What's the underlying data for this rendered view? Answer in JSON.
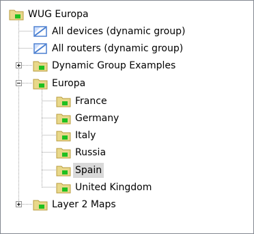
{
  "tree": {
    "root": {
      "label": "WUG Europa",
      "icon": "folder-icon"
    },
    "items": [
      {
        "label": "All devices (dynamic group)",
        "icon": "dynamic-group-icon"
      },
      {
        "label": "All routers (dynamic group)",
        "icon": "dynamic-group-icon"
      },
      {
        "label": "Dynamic Group Examples",
        "icon": "folder-icon",
        "expanded": false
      },
      {
        "label": "Europa",
        "icon": "folder-icon",
        "expanded": true,
        "children": [
          {
            "label": "France",
            "icon": "folder-icon"
          },
          {
            "label": "Germany",
            "icon": "folder-icon"
          },
          {
            "label": "Italy",
            "icon": "folder-icon"
          },
          {
            "label": "Russia",
            "icon": "folder-icon"
          },
          {
            "label": "Spain",
            "icon": "folder-icon",
            "selected": true
          },
          {
            "label": "United Kingdom",
            "icon": "folder-icon"
          }
        ]
      },
      {
        "label": "Layer 2 Maps",
        "icon": "folder-icon",
        "expanded": false
      }
    ]
  },
  "colors": {
    "folder": "#e8d88a",
    "folder_dark": "#b89b3c",
    "status_green": "#20c020",
    "selection": "#d9d9d9",
    "dynamic_group_blue": "#4a7fd0"
  }
}
